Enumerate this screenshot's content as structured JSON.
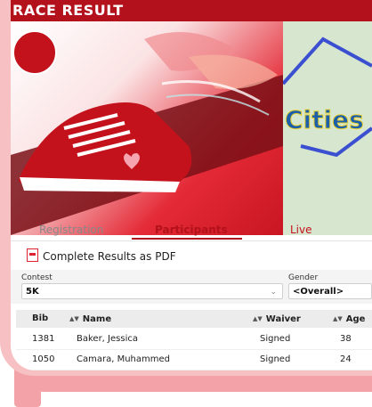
{
  "brand": {
    "name": "RACE RESULT"
  },
  "hero": {
    "logo_text": "",
    "map_caption": "Cities"
  },
  "tabs": [
    {
      "label": "Registration"
    },
    {
      "label": "Participants"
    },
    {
      "label": "Live"
    }
  ],
  "active_tab": "Participants",
  "pdf_link": {
    "label": "Complete Results as PDF"
  },
  "filters": {
    "contest": {
      "label": "Contest",
      "value": "5K"
    },
    "gender": {
      "label": "Gender",
      "value": "<Overall>"
    }
  },
  "table": {
    "columns": [
      "Bib",
      "Name",
      "Waiver",
      "Age"
    ],
    "rows": [
      {
        "bib": "1381",
        "name": "Baker, Jessica",
        "waiver": "Signed",
        "age": "38"
      },
      {
        "bib": "1050",
        "name": "Camara, Muhammed",
        "waiver": "Signed",
        "age": "24"
      }
    ]
  },
  "colors": {
    "brand_red": "#b3111b",
    "frame_pink": "#f3a3a8"
  }
}
